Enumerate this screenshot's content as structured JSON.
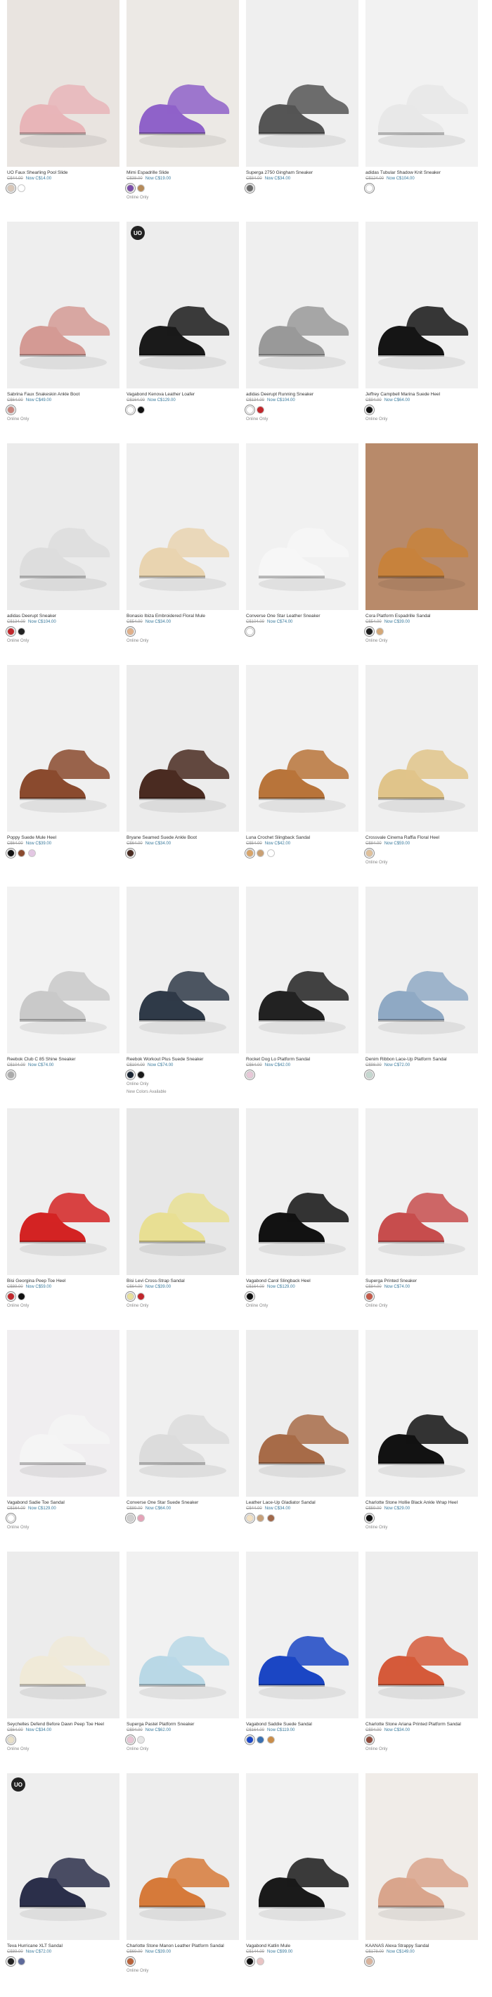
{
  "products": [
    {
      "name": "UO Faux Shearling Pool Slide",
      "was": "C$44.00",
      "now": "Now C$14.00",
      "bg": "#e9e4e0",
      "shoe": "#e8b5b8",
      "swatches": [
        "#d9c7b8",
        "#ffffff"
      ],
      "flags": []
    },
    {
      "name": "Mimi Espadrille Slide",
      "was": "C$38.00",
      "now": "Now C$19.00",
      "bg": "#ece9e5",
      "shoe": "#8f62c9",
      "swatches": [
        "#7b4ea8",
        "#b58a5a"
      ],
      "flags": [
        "Online Only"
      ]
    },
    {
      "name": "Superga 2750 Gingham Sneaker",
      "was": "C$84.00",
      "now": "Now C$34.00",
      "bg": "#efefef",
      "shoe": "#555555",
      "swatches": [
        "#6a6a6a"
      ],
      "flags": []
    },
    {
      "name": "adidas Tubular Shadow Knit Sneaker",
      "was": "C$124.00",
      "now": "Now C$104.00",
      "bg": "#f2f2f2",
      "shoe": "#e8e8e8",
      "swatches": [
        "#ffffff"
      ],
      "flags": []
    },
    {
      "name": "Sabrina Faux Snakeskin Ankle Boot",
      "was": "C$64.00",
      "now": "Now C$49.00",
      "bg": "#eeeeee",
      "shoe": "#d49a94",
      "swatches": [
        "#c8857d"
      ],
      "flags": [
        "Online Only"
      ]
    },
    {
      "name": "Vagabond Kenova Leather Loafer",
      "was": "C$164.00",
      "now": "Now C$129.00",
      "bg": "#ededed",
      "shoe": "#1a1a1a",
      "swatches": [
        "#ffffff",
        "#111111"
      ],
      "flags": [],
      "badge": "UO"
    },
    {
      "name": "adidas Deerupt Running Sneaker",
      "was": "C$134.00",
      "now": "Now C$104.00",
      "bg": "#efefef",
      "shoe": "#999999",
      "swatches": [
        "#ffffff",
        "#c0262b"
      ],
      "flags": [
        "Online Only"
      ]
    },
    {
      "name": "Jeffrey Campbell Marina Suede Heel",
      "was": "C$94.00",
      "now": "Now C$64.00",
      "bg": "#f0f0f0",
      "shoe": "#151515",
      "swatches": [
        "#111111"
      ],
      "flags": [
        "Online Only"
      ]
    },
    {
      "name": "adidas Deerupt Sneaker",
      "was": "C$134.00",
      "now": "Now C$104.00",
      "bg": "#ebebeb",
      "shoe": "#dddddd",
      "swatches": [
        "#c0262b",
        "#222222"
      ],
      "flags": [
        "Online Only"
      ]
    },
    {
      "name": "Bonasio Ibiza Embroidered Floral Mule",
      "was": "C$54.00",
      "now": "Now C$34.00",
      "bg": "#efefef",
      "shoe": "#e9d4b0",
      "swatches": [
        "#e0b089"
      ],
      "flags": [
        "Online Only"
      ]
    },
    {
      "name": "Converse One Star Leather Sneaker",
      "was": "C$104.00",
      "now": "Now C$74.00",
      "bg": "#f1f1f1",
      "shoe": "#f7f7f7",
      "swatches": [
        "#ffffff"
      ],
      "flags": []
    },
    {
      "name": "Cora Platform Espadrille Sandal",
      "was": "C$54.00",
      "now": "Now C$39.00",
      "bg": "#b88a6a",
      "shoe": "#c7823c",
      "swatches": [
        "#1d1d1d",
        "#d4a878"
      ],
      "flags": [
        "Online Only"
      ]
    },
    {
      "name": "Poppy Suede Mule Heel",
      "was": "C$64.00",
      "now": "Now C$39.00",
      "bg": "#f0f0f0",
      "shoe": "#8a4a2e",
      "swatches": [
        "#111111",
        "#8a4a2e",
        "#e3c7e3"
      ],
      "flags": []
    },
    {
      "name": "Bryane Seamed Suede Ankle Boot",
      "was": "C$64.00",
      "now": "Now C$34.00",
      "bg": "#ececec",
      "shoe": "#4a2b21",
      "swatches": [
        "#4a2b21"
      ],
      "flags": []
    },
    {
      "name": "Luna Crochet Slingback Sandal",
      "was": "C$54.00",
      "now": "Now C$42.00",
      "bg": "#f1f1f1",
      "shoe": "#b8743a",
      "swatches": [
        "#d9a468",
        "#c9a074",
        "#ffffff"
      ],
      "flags": []
    },
    {
      "name": "Crossvale Cinema Raffia Floral Heel",
      "was": "C$84.00",
      "now": "Now C$59.00",
      "bg": "#efefef",
      "shoe": "#e0c48a",
      "swatches": [
        "#e0c09a"
      ],
      "flags": [
        "Online Only"
      ]
    },
    {
      "name": "Reebok Club C 85 Shine Sneaker",
      "was": "C$104.00",
      "now": "Now C$74.00",
      "bg": "#f2f2f2",
      "shoe": "#c9c9c9",
      "swatches": [
        "#aaaaaa"
      ],
      "flags": []
    },
    {
      "name": "Reebok Workout Plus Suede Sneaker",
      "was": "C$104.00",
      "now": "Now C$74.00",
      "bg": "#eeeeee",
      "shoe": "#2f3a48",
      "swatches": [
        "#1a2533",
        "#1a1a1a"
      ],
      "flags": [
        "Online Only",
        "New Colors Available"
      ]
    },
    {
      "name": "Rocket Dog Lo Platform Sandal",
      "was": "C$64.00",
      "now": "Now C$42.00",
      "bg": "#f0f0f0",
      "shoe": "#222222",
      "swatches": [
        "#e8c8d8"
      ],
      "flags": []
    },
    {
      "name": "Denim Ribbon Lace-Up Platform Sandal",
      "was": "C$98.00",
      "now": "Now C$72.00",
      "bg": "#efefef",
      "shoe": "#8fa9c4",
      "swatches": [
        "#c5d8d0"
      ],
      "flags": []
    },
    {
      "name": "Bisi Georgina Peep Toe Heel",
      "was": "C$89.00",
      "now": "Now C$59.00",
      "bg": "#eeeeee",
      "shoe": "#d32323",
      "swatches": [
        "#c0262b",
        "#111111"
      ],
      "flags": [
        "Online Only"
      ]
    },
    {
      "name": "Bisi Levi Cross-Strap Sandal",
      "was": "C$64.00",
      "now": "Now C$39.00",
      "bg": "#e7e7e7",
      "shoe": "#e8df93",
      "swatches": [
        "#e8e09a",
        "#c0262b"
      ],
      "flags": [
        "Online Only"
      ]
    },
    {
      "name": "Vagabond Carol Slingback Heel",
      "was": "C$164.00",
      "now": "Now C$129.00",
      "bg": "#efefef",
      "shoe": "#121212",
      "swatches": [
        "#111111"
      ],
      "flags": [
        "Online Only"
      ]
    },
    {
      "name": "Superga Printed Sneaker",
      "was": "C$84.00",
      "now": "Now C$74.00",
      "bg": "#f0f0f0",
      "shoe": "#c74d4d",
      "swatches": [
        "#c45a4a"
      ],
      "flags": [
        "Online Only"
      ]
    },
    {
      "name": "Vagabond Sadie Toe Sandal",
      "was": "C$164.00",
      "now": "Now C$129.00",
      "bg": "#f0eef0",
      "shoe": "#f5f5f5",
      "swatches": [
        "#ffffff"
      ],
      "flags": [
        "Online Only"
      ]
    },
    {
      "name": "Converse One Star Suede Sneaker",
      "was": "C$89.00",
      "now": "Now C$64.00",
      "bg": "#efefef",
      "shoe": "#dcdcdc",
      "swatches": [
        "#cfcfcf",
        "#e4a3b7"
      ],
      "flags": []
    },
    {
      "name": "Leather Lace-Up Gladiator Sandal",
      "was": "C$44.00",
      "now": "Now C$34.00",
      "bg": "#ededed",
      "shoe": "#a76b48",
      "swatches": [
        "#f3e1c3",
        "#c6a07a",
        "#a0684a"
      ],
      "flags": []
    },
    {
      "name": "Charlotte Stone Hollie Black Ankle Wrap Heel",
      "was": "C$59.00",
      "now": "Now C$29.00",
      "bg": "#f1f1f1",
      "shoe": "#121212",
      "swatches": [
        "#111111"
      ],
      "flags": [
        "Online Only"
      ]
    },
    {
      "name": "Seychelles Defend Before Dawn Peep Toe Heel",
      "was": "C$64.00",
      "now": "Now C$34.00",
      "bg": "#ececec",
      "shoe": "#f0ead8",
      "swatches": [
        "#e9e0c8"
      ],
      "flags": [
        "Online Only"
      ]
    },
    {
      "name": "Superga Pastel Platform Sneaker",
      "was": "C$94.00",
      "now": "Now C$62.00",
      "bg": "#f1f1f1",
      "shoe": "#b9d8e6",
      "swatches": [
        "#e9c4d4",
        "#e6e6e6"
      ],
      "flags": [
        "Online Only"
      ]
    },
    {
      "name": "Vagabond Saddie Suede Sandal",
      "was": "C$164.00",
      "now": "Now C$119.00",
      "bg": "#f0f0f0",
      "shoe": "#1b46c4",
      "swatches": [
        "#1b46c4",
        "#3a6fb0",
        "#c98d4a"
      ],
      "flags": []
    },
    {
      "name": "Charlotte Stone Ariana Printed Platform Sandal",
      "was": "C$94.00",
      "now": "Now C$34.00",
      "bg": "#eeeeee",
      "shoe": "#d55a3a",
      "swatches": [
        "#8f4a3a"
      ],
      "flags": [
        "Online Only"
      ]
    },
    {
      "name": "Teva Hurricane XLT Sandal",
      "was": "C$89.00",
      "now": "Now C$72.00",
      "bg": "#eeeeee",
      "shoe": "#2b2f4a",
      "swatches": [
        "#222222",
        "#5e6a9a"
      ],
      "flags": [],
      "badge": "UO"
    },
    {
      "name": "Charlotte Stone Manon Leather Platform Sandal",
      "was": "C$69.00",
      "now": "Now C$39.00",
      "bg": "#ededed",
      "shoe": "#d67a3a",
      "swatches": [
        "#b8623a"
      ],
      "flags": [
        "Online Only"
      ]
    },
    {
      "name": "Vagabond Katlin Mule",
      "was": "C$144.00",
      "now": "Now C$99.00",
      "bg": "#f1f1f1",
      "shoe": "#1a1a1a",
      "swatches": [
        "#111111",
        "#e9c4c4"
      ],
      "flags": []
    },
    {
      "name": "KAANAS Alexa Strappy Sandal",
      "was": "C$178.00",
      "now": "Now C$149.00",
      "bg": "#f0ece8",
      "shoe": "#d9a58c",
      "swatches": [
        "#d9b39c"
      ],
      "flags": []
    }
  ]
}
